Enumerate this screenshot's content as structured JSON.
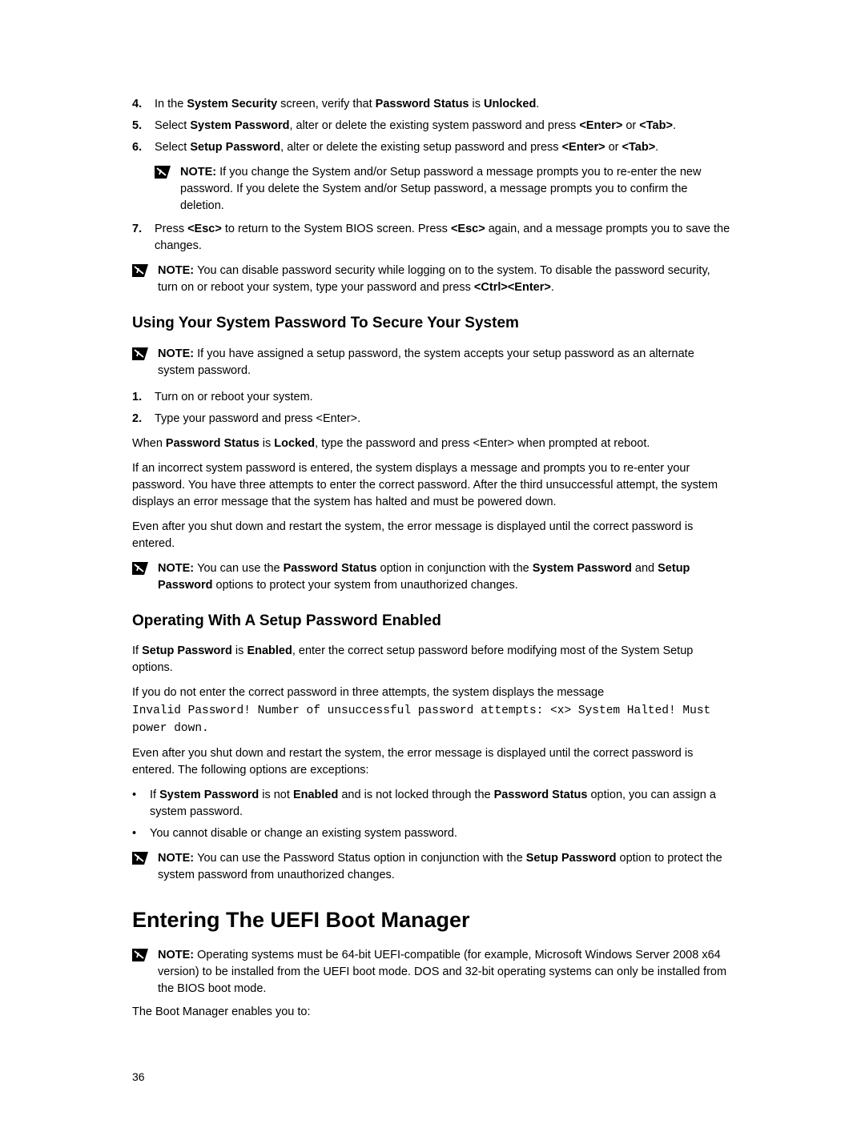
{
  "steps_top": {
    "s4": {
      "num": "4.",
      "pre": "In the ",
      "b1": "System Security",
      "mid": " screen, verify that ",
      "b2": "Password Status",
      "mid2": " is ",
      "b3": "Unlocked",
      "post": "."
    },
    "s5": {
      "num": "5.",
      "pre": "Select ",
      "b1": "System Password",
      "mid": ", alter or delete the existing system password and press ",
      "b2": "<Enter>",
      "mid2": " or ",
      "b3": "<Tab>",
      "post": "."
    },
    "s6": {
      "num": "6.",
      "pre": "Select ",
      "b1": "Setup Password",
      "mid": ", alter or delete the existing setup password and press ",
      "b2": "<Enter>",
      "mid2": " or ",
      "b3": "<Tab>",
      "post": "."
    },
    "note6": {
      "label": "NOTE: ",
      "text": "If you change the System and/or Setup password a message prompts you to re-enter the new password. If you delete the System and/or Setup password, a message prompts you to confirm the deletion."
    },
    "s7": {
      "num": "7.",
      "pre": "Press ",
      "b1": "<Esc>",
      "mid": " to return to the System BIOS screen. Press ",
      "b2": "<Esc>",
      "post": " again, and a message prompts you to save the changes."
    }
  },
  "note_disable": {
    "label": "NOTE: ",
    "pre": "You can disable password security while logging on to the system. To disable the password security, turn on or reboot your system, type your password and press ",
    "b1": "<Ctrl><Enter>",
    "post": "."
  },
  "heading1": "Using Your System Password To Secure Your System",
  "note_assigned": {
    "label": "NOTE: ",
    "text": "If you have assigned a setup password, the system accepts your setup password as an alternate system password."
  },
  "steps_mid": {
    "s1": {
      "num": "1.",
      "text": "Turn on or reboot your system."
    },
    "s2": {
      "num": "2.",
      "text": "Type your password and press <Enter>."
    }
  },
  "para_when": {
    "pre": "When ",
    "b1": "Password Status",
    "mid": " is ",
    "b2": "Locked",
    "post": ", type the password and press <Enter> when prompted at reboot."
  },
  "para_incorrect": "If an incorrect system password is entered, the system displays a message and prompts you to re-enter your password. You have three attempts to enter the correct password. After the third unsuccessful attempt, the system displays an error message that the system has halted and must be powered down.",
  "para_even1": "Even after you shut down and restart the system, the error message is displayed until the correct password is entered.",
  "note_pwstatus": {
    "label": "NOTE: ",
    "pre": "You can use the ",
    "b1": "Password Status",
    "mid": " option in conjunction with the ",
    "b2": "System Password",
    "mid2": " and ",
    "b3": "Setup Password",
    "post": " options to protect your system from unauthorized changes."
  },
  "heading2": "Operating With A Setup Password Enabled",
  "para_ifsetup": {
    "pre": "If ",
    "b1": "Setup Password",
    "mid": " is ",
    "b2": "Enabled",
    "post": ", enter the correct setup password before modifying most of the System Setup options."
  },
  "para_ifnot": "If you do not enter the correct password in three attempts, the system displays the message",
  "code": "Invalid Password! Number of unsuccessful password attempts: <x> System Halted! Must power down.",
  "para_even2": "Even after you shut down and restart the system, the error message is displayed until the correct password is entered. The following options are exceptions:",
  "bullets": {
    "b1": {
      "pre": "If ",
      "bold1": "System Password",
      "mid": " is not ",
      "bold2": "Enabled",
      "mid2": " and is not locked through the ",
      "bold3": "Password Status",
      "post": " option, you can assign a system password."
    },
    "b2": "You cannot disable or change an existing system password."
  },
  "note_setupopt": {
    "label": "NOTE: ",
    "pre": "You can use the Password Status option in conjunction with the ",
    "b1": "Setup Password",
    "post": " option to protect the system password from unauthorized changes."
  },
  "main_heading": "Entering The UEFI Boot Manager",
  "note_uefi": {
    "label": "NOTE: ",
    "text": "Operating systems must be 64-bit UEFI-compatible (for example, Microsoft Windows Server 2008 x64 version) to be installed from the UEFI boot mode. DOS and 32-bit operating systems can only be installed from the BIOS boot mode."
  },
  "para_bootmgr": "The Boot Manager enables you to:",
  "page_number": "36"
}
